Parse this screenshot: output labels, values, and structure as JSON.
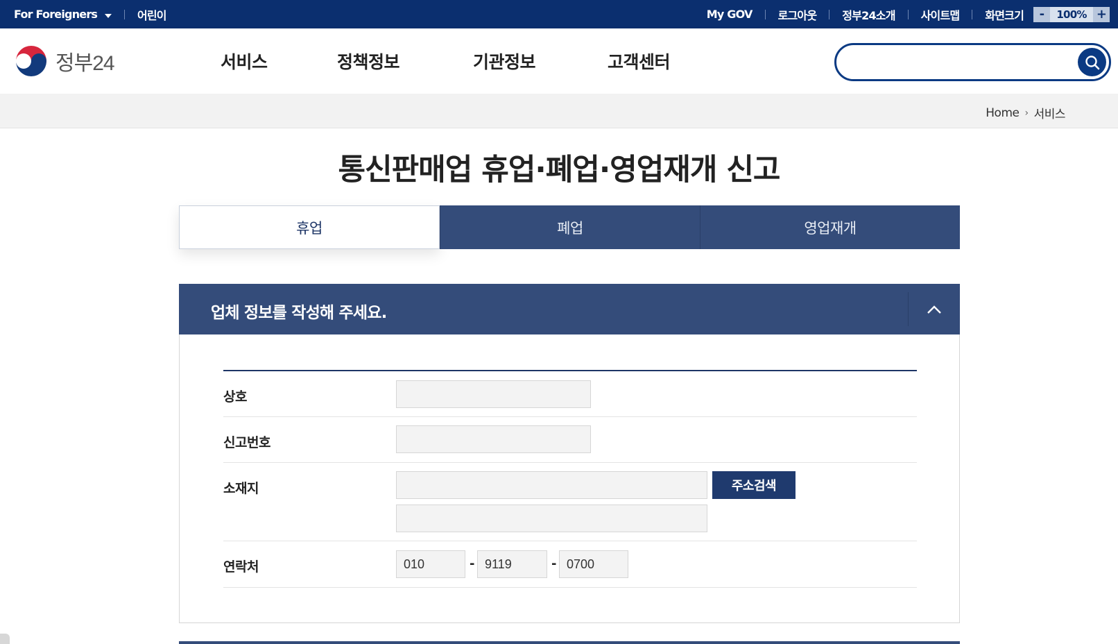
{
  "topbar": {
    "foreigners": "For Foreigners",
    "kids": "어린이",
    "links": [
      "My GOV",
      "로그아웃",
      "정부24소개",
      "사이트맵"
    ],
    "zoom_label": "화면크기",
    "zoom_minus": "-",
    "zoom_value": "100%",
    "zoom_plus": "+"
  },
  "header": {
    "logo_text": "정부24",
    "nav": [
      "서비스",
      "정책정보",
      "기관정보",
      "고객센터"
    ],
    "search_placeholder": ""
  },
  "breadcrumb": {
    "home": "Home",
    "current": "서비스"
  },
  "page": {
    "title": "통신판매업 휴업·폐업·영업재개 신고"
  },
  "tabs": [
    {
      "label": "휴업",
      "active": true
    },
    {
      "label": "폐업",
      "active": false
    },
    {
      "label": "영업재개",
      "active": false
    }
  ],
  "section": {
    "title": "업체 정보를 작성해 주세요.",
    "fields": {
      "company_label": "상호",
      "company_value": "",
      "report_no_label": "신고번호",
      "report_no_value": "",
      "address_label": "소재지",
      "address_value_1": "",
      "address_value_2": "",
      "address_search_button": "주소검색",
      "contact_label": "연락처",
      "phone_1": "010",
      "phone_2": "9119",
      "phone_3": "0700",
      "phone_separator": "-"
    }
  },
  "colors": {
    "topbar_bg": "#0b2f6f",
    "accent_navy": "#344c7a",
    "search_border": "#0b3a83"
  }
}
